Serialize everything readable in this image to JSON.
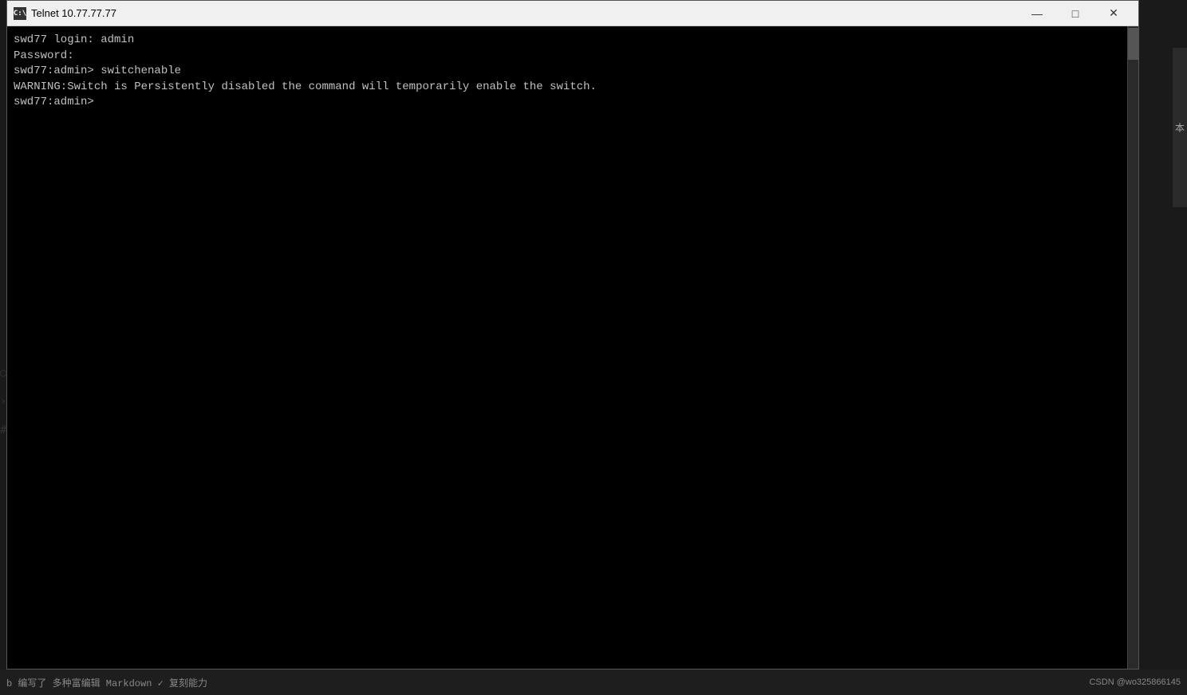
{
  "window": {
    "title": "Telnet 10.77.77.77",
    "icon_label": "C:\\",
    "controls": {
      "minimize": "—",
      "maximize": "□",
      "close": "✕"
    }
  },
  "terminal": {
    "lines": [
      "swd77 login: admin",
      "Password:",
      "swd77:admin> switchenable",
      "WARNING:Switch is Persistently disabled the command will temporarily enable the switch.",
      "swd77:admin>"
    ]
  },
  "bottom_bar": {
    "text": "b  编写了 多种富编辑 Markdown ✓ 复刻能力",
    "watermark": "CSDN @wo325866145"
  },
  "right_sidebar": {
    "label": "本"
  }
}
